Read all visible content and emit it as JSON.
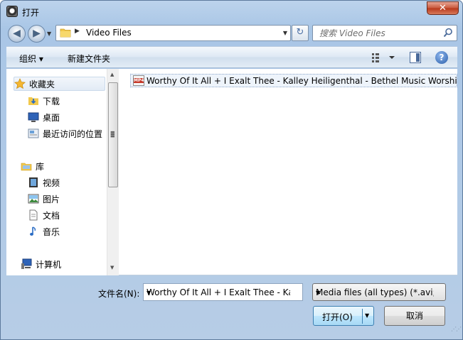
{
  "window": {
    "title": "打开",
    "close_label": "✕"
  },
  "address_bar": {
    "path_segment": "Video Files"
  },
  "search": {
    "placeholder": "搜索 Video Files"
  },
  "toolbar": {
    "organize_label": "组织 ▾",
    "new_folder_label": "新建文件夹"
  },
  "sidebar": {
    "favorites": {
      "label": "收藏夹",
      "items": [
        {
          "label": "下载",
          "icon": "downloads-folder-icon"
        },
        {
          "label": "桌面",
          "icon": "desktop-icon"
        },
        {
          "label": "最近访问的位置",
          "icon": "recent-places-icon"
        }
      ]
    },
    "libraries": {
      "label": "库",
      "items": [
        {
          "label": "视频",
          "icon": "videos-library-icon"
        },
        {
          "label": "图片",
          "icon": "pictures-library-icon"
        },
        {
          "label": "文档",
          "icon": "documents-library-icon"
        },
        {
          "label": "音乐",
          "icon": "music-library-icon"
        }
      ]
    },
    "computer": {
      "label": "计算机"
    }
  },
  "files": [
    {
      "name": "Worthy Of It All + I Exalt Thee - Kalley Heiligenthal - Bethel Music Worship_",
      "icon_text": "MP4"
    }
  ],
  "footer": {
    "filename_label": "文件名(N):",
    "filename_value": "Worthy Of It All + I Exalt Thee - Ka",
    "filetype_value": "Media files (all types) (*.avi;*",
    "open_label": "打开(O)",
    "cancel_label": "取消"
  },
  "colors": {
    "accent": "#3c7fb1",
    "selection_bg": "#eef4fb",
    "frame": "#a9c6e6"
  }
}
